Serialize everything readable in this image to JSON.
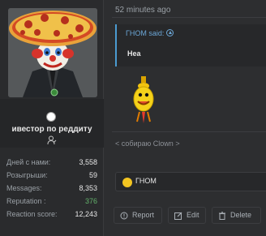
{
  "post": {
    "time": "52 minutes ago",
    "quote": {
      "author": "ГНОМ said:",
      "text": "Неа"
    },
    "signature": "< собираю Clown >",
    "reaction": {
      "name": "ГНОМ"
    }
  },
  "user": {
    "title": "ивестор по реддиту",
    "stats": [
      {
        "label": "Дней с нами:",
        "value": "3,558"
      },
      {
        "label": "Розыгрыши:",
        "value": "59"
      },
      {
        "label": "Messages:",
        "value": "8,353"
      },
      {
        "label": "Reputation :",
        "value": "376"
      },
      {
        "label": "Reaction score:",
        "value": "12,243"
      }
    ]
  },
  "actions": {
    "report": "Report",
    "edit": "Edit",
    "delete": "Delete"
  },
  "colors": {
    "positive": "#63b26b",
    "quote_accent": "#4b9bd1",
    "background": "#2d2e30"
  }
}
